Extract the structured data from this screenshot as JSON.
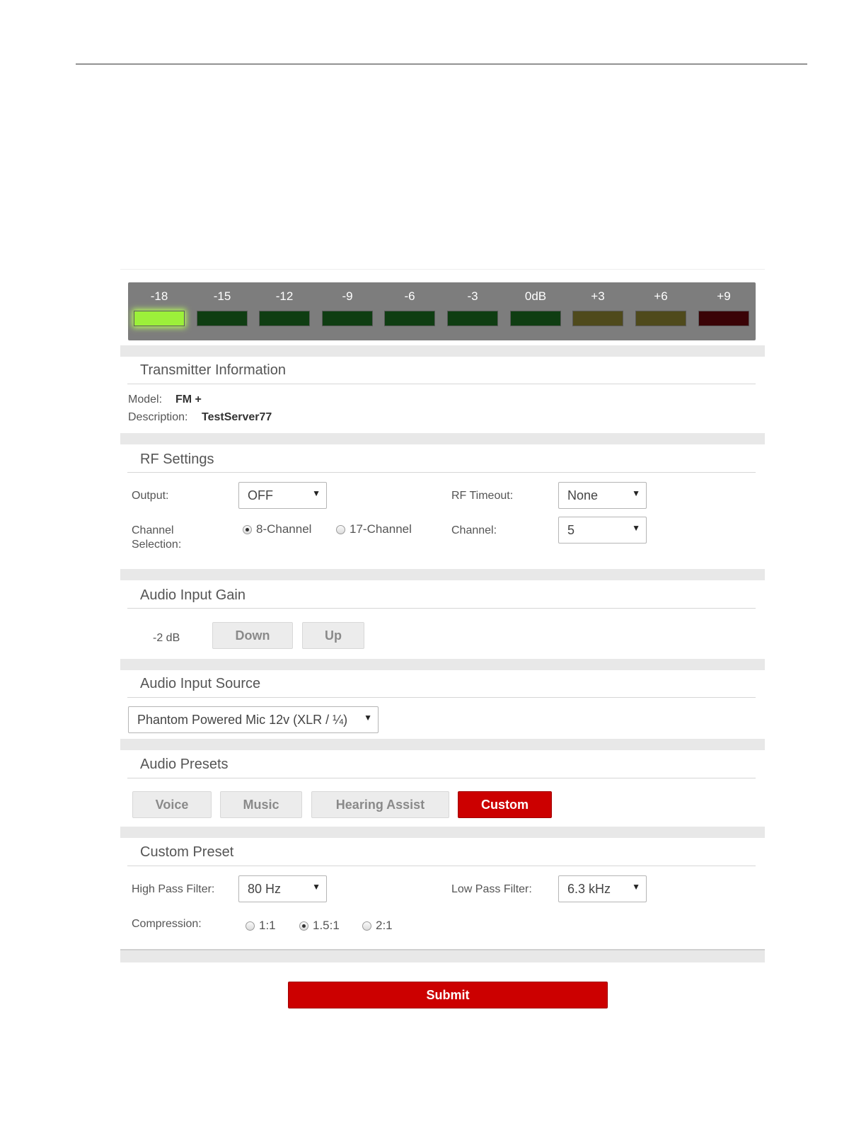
{
  "meter": {
    "labels": [
      "-18",
      "-15",
      "-12",
      "-9",
      "-6",
      "-3",
      "0dB",
      "+3",
      "+6",
      "+9"
    ],
    "colors": [
      "#9cf03a",
      "#0f3d12",
      "#0f3d12",
      "#0f3d12",
      "#0f3d12",
      "#0f3d12",
      "#0f3d12",
      "#4f4a1c",
      "#4f4a1c",
      "#3a0306"
    ],
    "active_index": 0
  },
  "transmitter": {
    "title": "Transmitter Information",
    "model_label": "Model:",
    "model_value": "FM +",
    "description_label": "Description:",
    "description_value": "TestServer77"
  },
  "rf": {
    "title": "RF Settings",
    "output_label": "Output:",
    "output_value": "OFF",
    "timeout_label": "RF Timeout:",
    "timeout_value": "None",
    "channel_selection_label_1": "Channel",
    "channel_selection_label_2": "Selection:",
    "radio_8": "8-Channel",
    "radio_17": "17-Channel",
    "selected_mode": "8-Channel",
    "channel_label": "Channel:",
    "channel_value": "5"
  },
  "gain": {
    "title": "Audio Input Gain",
    "value": "-2 dB",
    "down_label": "Down",
    "up_label": "Up"
  },
  "source": {
    "title": "Audio Input Source",
    "value": "Phantom Powered Mic 12v (XLR / ¼)"
  },
  "presets": {
    "title": "Audio Presets",
    "voice": "Voice",
    "music": "Music",
    "hearing": "Hearing Assist",
    "custom": "Custom",
    "active": "Custom",
    "active_color": "#cc0000"
  },
  "custom": {
    "title": "Custom Preset",
    "hpf_label": "High Pass Filter:",
    "hpf_value": "80 Hz",
    "lpf_label": "Low Pass Filter:",
    "lpf_value": "6.3 kHz",
    "compression_label": "Compression:",
    "comp_1": "1:1",
    "comp_2": "1.5:1",
    "comp_3": "2:1",
    "comp_selected": "1.5:1"
  },
  "submit_label": "Submit"
}
